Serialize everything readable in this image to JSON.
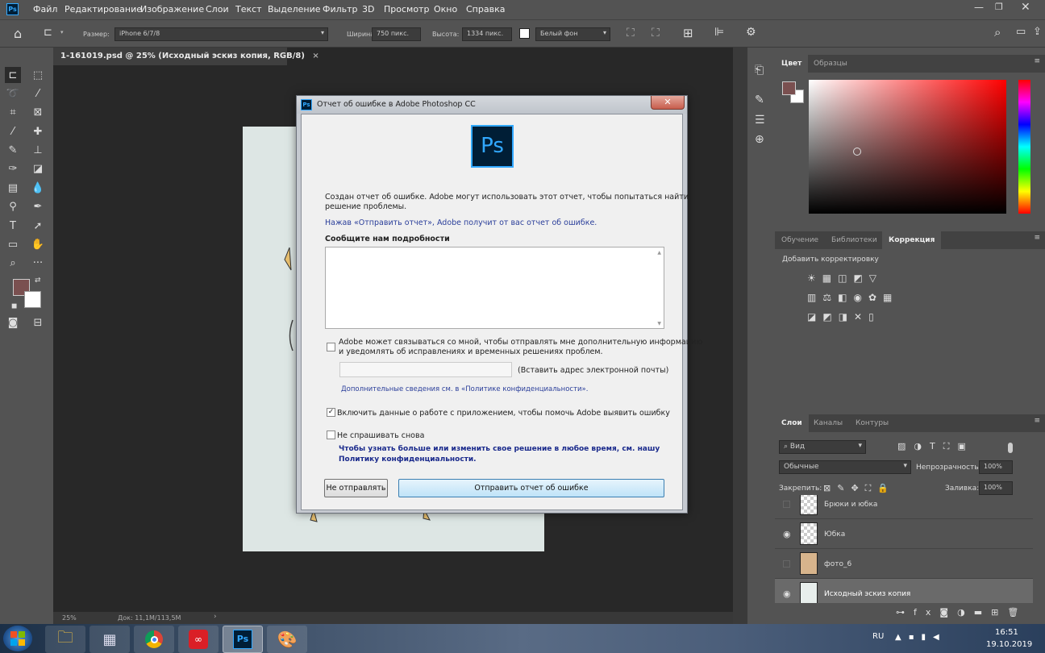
{
  "menu": {
    "app_icon": "Ps",
    "items": [
      "Файл",
      "Редактирование",
      "Изображение",
      "Слои",
      "Текст",
      "Выделение",
      "Фильтр",
      "3D",
      "Просмотр",
      "Окно",
      "Справка"
    ]
  },
  "options": {
    "size_label": "Размер:",
    "size_value": "iPhone 6/7/8",
    "width_label": "Ширина:",
    "width_value": "750 пикс.",
    "height_label": "Высота:",
    "height_value": "1334 пикс.",
    "bg_value": "Белый фон"
  },
  "document": {
    "tab_title": "1-161019.psd @ 25% (Исходный эскиз копия, RGB/8)",
    "close": "×",
    "zoom": "25%",
    "doc_info": "Док: 11,1M/113,5M"
  },
  "panels": {
    "color_tabs": [
      "Цвет",
      "Образцы"
    ],
    "adjust_tabs": [
      "Обучение",
      "Библиотеки",
      "Коррекция"
    ],
    "adjust_title": "Добавить корректировку",
    "layers_tabs": [
      "Слои",
      "Каналы",
      "Контуры"
    ],
    "search_kind": "Вид",
    "blend_mode": "Обычные",
    "opacity_label": "Непрозрачность:",
    "opacity_value": "100%",
    "lock_label": "Закрепить:",
    "fill_label": "Заливка:",
    "fill_value": "100%",
    "layers": [
      {
        "name": "Брюки и юбка",
        "visible": false
      },
      {
        "name": "Юбка",
        "visible": true
      },
      {
        "name": "фото_6",
        "visible": false
      },
      {
        "name": "Исходный эскиз копия",
        "visible": true
      }
    ]
  },
  "colors": {
    "foreground": "#7a5050",
    "background": "#ffffff",
    "accent": "#31a8ff"
  },
  "dialog": {
    "title": "Отчет об ошибке в Adobe Photoshop CC",
    "logo": "Ps",
    "intro_line1": "Создан отчет об ошибке. Adobe могут использовать этот отчет, чтобы попытаться найти",
    "intro_line2": "решение проблемы.",
    "intro_link": "Нажав «Отправить отчет», Adobe получит от вас отчет об ошибке.",
    "details_label": "Сообщите нам подробности",
    "contact_line1": "Adobe может связываться со мной, чтобы отправлять мне дополнительную информацию",
    "contact_line2": "и уведомлять об исправлениях и временных решениях проблем.",
    "email_placeholder": "(Вставить адрес электронной почты)",
    "privacy_link": "Дополнительные сведения см. в «Политике конфиденциальности».",
    "include_data": "Включить данные о работе с приложением, чтобы помочь Adobe выявить ошибку",
    "dont_ask": "Не спрашивать снова",
    "info_line1": "Чтобы узнать больше или изменить свое решение в любое время, см. нашу",
    "info_line2": "Политику конфиденциальности.",
    "btn_dont_send": "Не отправлять",
    "btn_send": "Отправить отчет об ошибке"
  },
  "taskbar": {
    "lang": "RU",
    "time": "16:51",
    "date": "19.10.2019"
  }
}
